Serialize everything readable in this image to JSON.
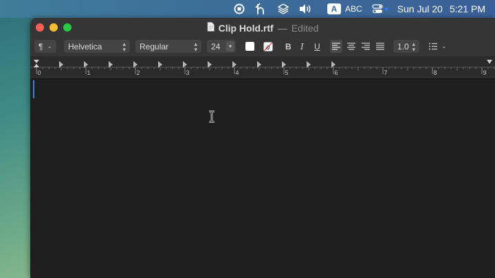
{
  "menubar": {
    "icons": [
      "record-icon",
      "h-app-icon",
      "layers-icon",
      "volume-icon",
      "input-source-icon",
      "control-center-icon"
    ],
    "input_letter": "A",
    "input_label": "ABC",
    "date": "Sun Jul 20",
    "time": "5:21 PM"
  },
  "window": {
    "filename": "Clip Hold.rtf",
    "separator": "—",
    "status": "Edited"
  },
  "toolbar": {
    "paragraph_style": "¶",
    "font_family": "Helvetica",
    "font_style": "Regular",
    "font_size": "24",
    "bold": "B",
    "italic": "I",
    "underline": "U",
    "line_spacing": "1.0",
    "text_color": "#ffffff"
  },
  "ruler": {
    "labels": [
      "0",
      "1",
      "2",
      "3",
      "4",
      "5",
      "6",
      "7",
      "8",
      "9"
    ]
  },
  "colors": {
    "accent": "#3a82f6",
    "close": "#fe5f57",
    "minimize": "#febc2e",
    "maximize": "#28c840"
  }
}
